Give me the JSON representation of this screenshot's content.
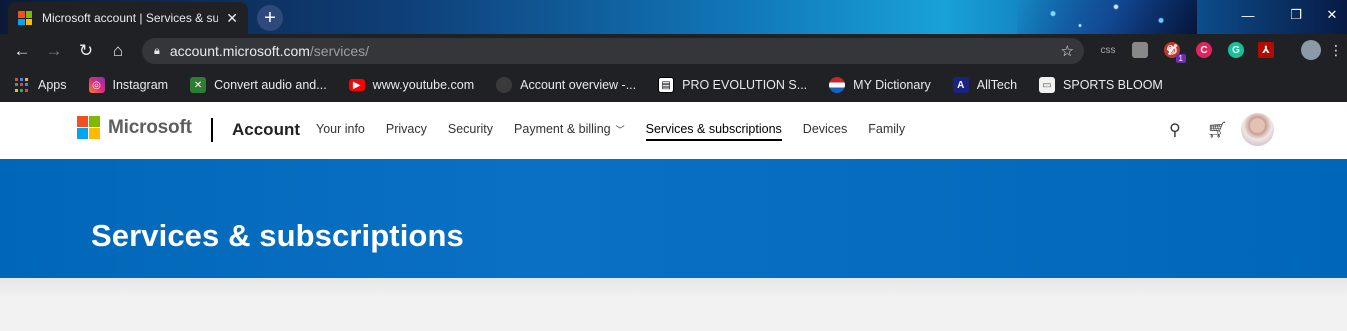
{
  "browser": {
    "tab_title": "Microsoft account | Services & su",
    "url_host": "account.microsoft.com",
    "url_path": "/services/",
    "extensions": {
      "css_label": "css",
      "badge_count": "1"
    }
  },
  "bookmarks": [
    {
      "label": "Apps",
      "icon": "apps-grid-icon"
    },
    {
      "label": "Instagram",
      "icon": "instagram-icon"
    },
    {
      "label": "Convert audio and...",
      "icon": "convert-icon"
    },
    {
      "label": "www.youtube.com",
      "icon": "youtube-icon"
    },
    {
      "label": "Account overview -...",
      "icon": "account-icon"
    },
    {
      "label": "PRO EVOLUTION S...",
      "icon": "pes-icon"
    },
    {
      "label": "MY Dictionary",
      "icon": "dictionary-icon"
    },
    {
      "label": "AllTech",
      "icon": "alltech-icon"
    },
    {
      "label": "SPORTS BLOOM",
      "icon": "sports-bloom-icon"
    }
  ],
  "header": {
    "logo_text": "Microsoft",
    "section_title": "Account",
    "nav": [
      {
        "label": "Your info"
      },
      {
        "label": "Privacy"
      },
      {
        "label": "Security"
      },
      {
        "label": "Payment & billing",
        "has_dropdown": true
      },
      {
        "label": "Services & subscriptions",
        "active": true
      },
      {
        "label": "Devices"
      },
      {
        "label": "Family"
      }
    ]
  },
  "page": {
    "title": "Services & subscriptions"
  },
  "colors": {
    "banner": "#0067b8",
    "ms_red": "#f25022",
    "ms_green": "#7fba00",
    "ms_blue": "#00a4ef",
    "ms_yellow": "#ffb900"
  }
}
